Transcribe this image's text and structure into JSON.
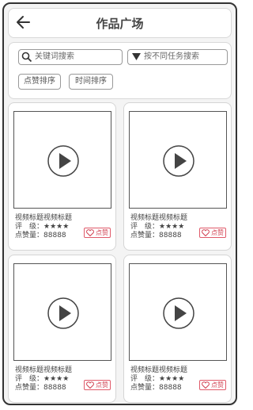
{
  "header": {
    "title": "作品广场"
  },
  "filters": {
    "search_placeholder": "关键词搜索",
    "task_filter_label": "按不同任务搜索",
    "sort_by_likes": "点赞排序",
    "sort_by_time": "时间排序"
  },
  "cards": [
    {
      "title": "视频标题视频标题",
      "rating_label": "评　级：",
      "rating_stars": "★★★★",
      "likes_label": "点赞量：",
      "likes": "88888",
      "like_button": "点赞"
    },
    {
      "title": "视频标题视频标题",
      "rating_label": "评　级：",
      "rating_stars": "★★★★",
      "likes_label": "点赞量：",
      "likes": "88888",
      "like_button": "点赞"
    },
    {
      "title": "视频标题视频标题",
      "rating_label": "评　级：",
      "rating_stars": "★★★★",
      "likes_label": "点赞量：",
      "likes": "88888",
      "like_button": "点赞"
    },
    {
      "title": "视频标题视频标题",
      "rating_label": "评　级：",
      "rating_stars": "★★★★",
      "likes_label": "点赞量：",
      "likes": "88888",
      "like_button": "点赞"
    }
  ],
  "colors": {
    "accent_like": "#d04050",
    "border": "#333333"
  }
}
